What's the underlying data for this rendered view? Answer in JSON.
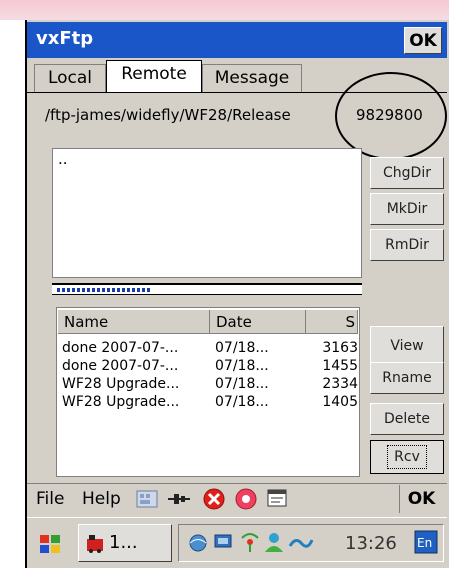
{
  "window": {
    "title": "vxFtp",
    "ok_label": "OK"
  },
  "tabs": [
    {
      "label": "Local"
    },
    {
      "label": "Remote"
    },
    {
      "label": "Message"
    }
  ],
  "remote_path": "/ftp-james/widefly/WF28/Release",
  "port_value": "9829800",
  "directory_list": {
    "items": [
      ".."
    ]
  },
  "dir_buttons": {
    "chgdir": "ChgDir",
    "mkdir": "MkDir",
    "rmdir": "RmDir"
  },
  "progress": {
    "fraction": 0.31
  },
  "file_list": {
    "columns": [
      "Name",
      "Date",
      "S"
    ],
    "rows": [
      {
        "name": "done 2007-07-...",
        "date": "07/18...",
        "size": "3163"
      },
      {
        "name": "done 2007-07-...",
        "date": "07/18...",
        "size": "1455"
      },
      {
        "name": "WF28 Upgrade...",
        "date": "07/18...",
        "size": "2334"
      },
      {
        "name": "WF28 Upgrade...",
        "date": "07/18...",
        "size": "1405"
      }
    ]
  },
  "file_buttons": {
    "view": "View",
    "rename": "Rname",
    "delete": "Delete",
    "receive": "Rcv"
  },
  "menubar": {
    "file": "File",
    "help": "Help",
    "ok_label": "OK"
  },
  "taskbar": {
    "task_label": "1...",
    "clock": "13:26"
  },
  "colors": {
    "titlebar": "#1a56c8",
    "chrome": "#d4d0c8",
    "top_band": "#f6c9d4"
  }
}
